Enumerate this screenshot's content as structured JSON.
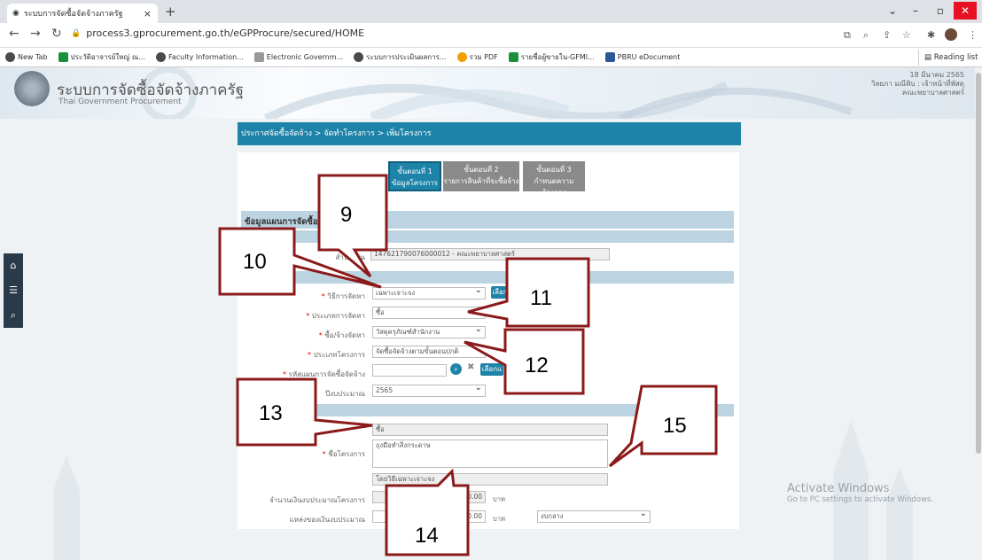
{
  "browser": {
    "tab_title": "ระบบการจัดซื้อจัดจ้างภาครัฐ",
    "url": "process3.gprocurement.go.th/eGPProcure/secured/HOME",
    "bookmarks": [
      {
        "label": "New Tab",
        "color": "#4a4a4a"
      },
      {
        "label": "ประวัติอาจารย์ใหญ่ ณ...",
        "color": "#1a8f3c"
      },
      {
        "label": "Faculty Information...",
        "color": "#4a4a4a"
      },
      {
        "label": "Electronic Governm...",
        "color": "#999999"
      },
      {
        "label": "ระบบการประเมินผลการ...",
        "color": "#4a4a4a"
      },
      {
        "label": "รวม PDF",
        "color": "#f0a000"
      },
      {
        "label": "รายชื่อผู้ขายใน-GFMI...",
        "color": "#1a8f3c"
      },
      {
        "label": "PBRU eDocument",
        "color": "#2b5797"
      }
    ],
    "reading_list": "Reading list"
  },
  "site": {
    "title": "ระบบการจัดซื้อจัดจ้างภาครัฐ",
    "subtitle": "Thai Government Procurement",
    "date": "18 มีนาคม 2565",
    "user_line1": "วิลยภา มณีพิบ : เจ้าหน้าที่พัสดุ",
    "user_line2": "คณะพยาบาลศาสตร์"
  },
  "breadcrumb": "ประกาศจัดซื้อจัดจ้าง > จัดทำโครงการ > เพิ่มโครงการ",
  "steps": [
    {
      "line1": "ขั้นตอนที่ 1",
      "line2": "ข้อมูลโครงการ"
    },
    {
      "line1": "ขั้นตอนที่ 2",
      "line2": "รายการสินค้าที่จะซื้อจ้าง"
    },
    {
      "line1": "ขั้นตอนที่ 3",
      "line2": "กำหนดความต้องการ"
    }
  ],
  "form": {
    "section_title": "ข้อมูลแผนการจัดซื้อจัดจ้างภาครัฐ",
    "agency_label": "สำนักงาน",
    "agency_value": "147621790076000012 - คณะพยาบาลศาสตร์",
    "method_label": "วิธีการจัดหา",
    "method_value": "เฉพาะเจาะจง",
    "type_label": "ประเภทการจัดหา",
    "type_value": "ซื้อ",
    "sub_label": "ซื้อ/จ้างจัดหา",
    "sub_value": "วัสดุครุภัณฑ์สำนักงาน",
    "project_type_label": "ประเภทโครงการ",
    "project_type_value": "จัดซื้อจัดจ้างตามขั้นตอนปกติ",
    "plan_label": "รหัสแผนการจัดซื้อจัดจ้าง",
    "select_btn": "เลือก",
    "select_btn2": "เลือกแ",
    "year_label": "ปีงบประมาณ",
    "year_value": "2565",
    "buy_value": "ซื้อ",
    "project_name_label": "ชื่อโครงการ",
    "project_name_value": "ถุงมือทำสิ่งกระดาษ",
    "method_suffix": "โดยวิธีเฉพาะเจาะจง",
    "budget_label": "จำนวนเงินงบประมาณโครงการ",
    "budget_value": "0.00",
    "budget_unit": "บาท",
    "source_label": "แหล่งของเงินงบประมาณ",
    "source_value": "0.00",
    "source_unit": "บาท",
    "source_select": "งบกลาง"
  },
  "callouts": [
    "9",
    "10",
    "11",
    "12",
    "13",
    "14",
    "15"
  ],
  "watermark": {
    "line1": "Activate Windows",
    "line2": "Go to PC settings to activate Windows."
  }
}
